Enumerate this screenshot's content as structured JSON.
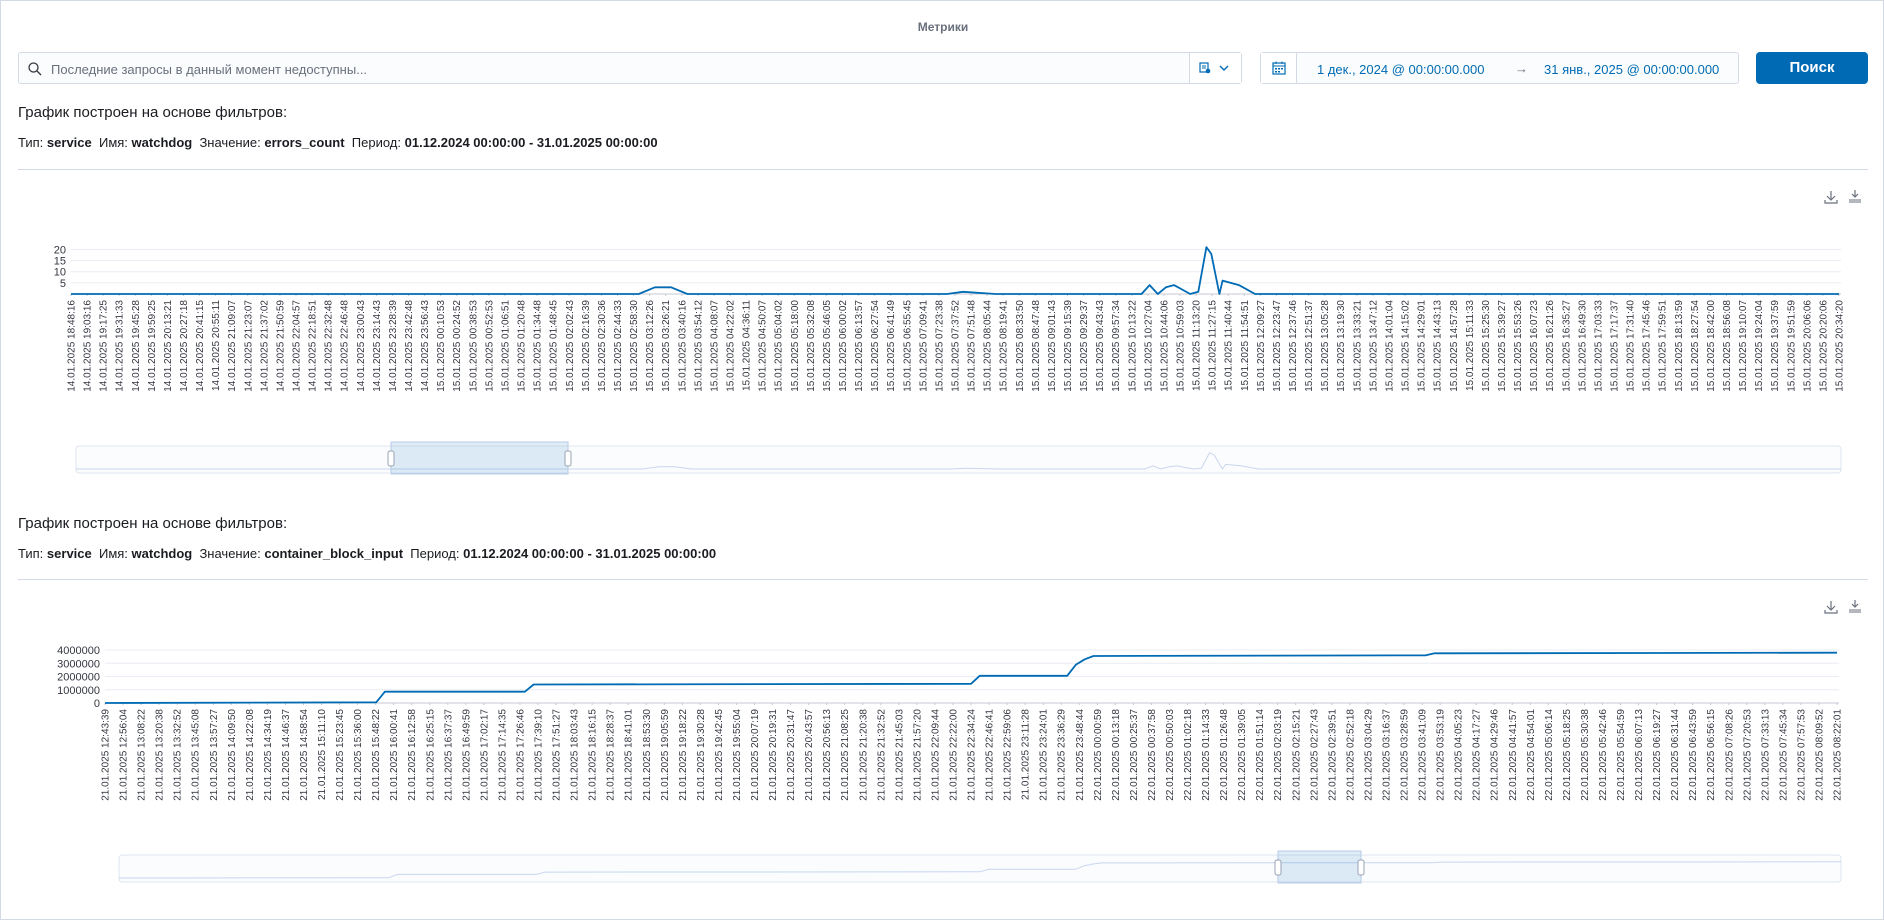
{
  "page": {
    "title": "Метрики"
  },
  "search": {
    "placeholder": "Последние запросы в данный момент недоступны..."
  },
  "date_picker": {
    "start": "1 дек., 2024 @ 00:00:00.000",
    "arrow": "→",
    "end": "31 янв., 2025 @ 00:00:00.000"
  },
  "search_button": {
    "label": "Поиск"
  },
  "colors": {
    "accent": "#006bb4",
    "line": "#006bb4",
    "border": "#d3dae6"
  },
  "icons": {
    "search": "search-icon",
    "query_menu": "saved-query-icon",
    "chevron": "chevron-down-icon",
    "calendar": "calendar-icon",
    "download": "download-icon",
    "download_alt": "download-alt-icon"
  },
  "charts": [
    {
      "heading": "График построен на основе фильтров:",
      "filters": {
        "type_label": "Тип:",
        "type_value": "service",
        "name_label": "Имя:",
        "name_value": "watchdog",
        "value_label": "Значение:",
        "value_value": "errors_count",
        "period_label": "Период:",
        "period_value": "01.12.2024 00:00:00 - 31.01.2025 00:00:00"
      }
    },
    {
      "heading": "График построен на основе фильтров:",
      "filters": {
        "type_label": "Тип:",
        "type_value": "service",
        "name_label": "Имя:",
        "name_value": "watchdog",
        "value_label": "Значение:",
        "value_value": "container_block_input",
        "period_label": "Период:",
        "period_value": "01.12.2024 00:00:00 - 31.01.2025 00:00:00"
      }
    }
  ],
  "chart_data": [
    {
      "type": "line",
      "yticks": [
        5,
        10,
        15,
        20
      ],
      "ylim": [
        0,
        22
      ],
      "xticks": [
        "14.01.2025 18:48:16",
        "14.01.2025 19:03:16",
        "14.01.2025 19:17:25",
        "14.01.2025 19:31:33",
        "14.01.2025 19:45:28",
        "14.01.2025 19:59:25",
        "14.01.2025 20:13:21",
        "14.01.2025 20:27:18",
        "14.01.2025 20:41:15",
        "14.01.2025 20:55:11",
        "14.01.2025 21:09:07",
        "14.01.2025 21:23:07",
        "14.01.2025 21:37:02",
        "14.01.2025 21:50:59",
        "14.01.2025 22:04:57",
        "14.01.2025 22:18:51",
        "14.01.2025 22:32:48",
        "14.01.2025 22:46:48",
        "14.01.2025 23:00:43",
        "14.01.2025 23:14:43",
        "14.01.2025 23:28:39",
        "14.01.2025 23:42:48",
        "14.01.2025 23:56:43",
        "15.01.2025 00:10:53",
        "15.01.2025 00:24:52",
        "15.01.2025 00:38:53",
        "15.01.2025 00:52:53",
        "15.01.2025 01:06:51",
        "15.01.2025 01:20:48",
        "15.01.2025 01:34:48",
        "15.01.2025 01:48:45",
        "15.01.2025 02:02:43",
        "15.01.2025 02:16:39",
        "15.01.2025 02:30:36",
        "15.01.2025 02:44:33",
        "15.01.2025 02:58:30",
        "15.01.2025 03:12:26",
        "15.01.2025 03:26:21",
        "15.01.2025 03:40:16",
        "15.01.2025 03:54:12",
        "15.01.2025 04:08:07",
        "15.01.2025 04:22:02",
        "15.01.2025 04:36:11",
        "15.01.2025 04:50:07",
        "15.01.2025 05:04:02",
        "15.01.2025 05:18:00",
        "15.01.2025 05:32:08",
        "15.01.2025 05:46:05",
        "15.01.2025 06:00:02",
        "15.01.2025 06:13:57",
        "15.01.2025 06:27:54",
        "15.01.2025 06:41:49",
        "15.01.2025 06:55:45",
        "15.01.2025 07:09:41",
        "15.01.2025 07:23:38",
        "15.01.2025 07:37:52",
        "15.01.2025 07:51:48",
        "15.01.2025 08:05:44",
        "15.01.2025 08:19:41",
        "15.01.2025 08:33:50",
        "15.01.2025 08:47:48",
        "15.01.2025 09:01:43",
        "15.01.2025 09:15:39",
        "15.01.2025 09:29:37",
        "15.01.2025 09:43:43",
        "15.01.2025 09:57:34",
        "15.01.2025 10:13:22",
        "15.01.2025 10:27:04",
        "15.01.2025 10:44:06",
        "15.01.2025 10:59:03",
        "15.01.2025 11:13:20",
        "15.01.2025 11:27:15",
        "15.01.2025 11:40:44",
        "15.01.2025 11:54:51",
        "15.01.2025 12:09:27",
        "15.01.2025 12:23:47",
        "15.01.2025 12:37:46",
        "15.01.2025 12:51:37",
        "15.01.2025 13:05:28",
        "15.01.2025 13:19:30",
        "15.01.2025 13:33:21",
        "15.01.2025 13:47:12",
        "15.01.2025 14:01:04",
        "15.01.2025 14:15:02",
        "15.01.2025 14:29:01",
        "15.01.2025 14:43:13",
        "15.01.2025 14:57:28",
        "15.01.2025 15:11:33",
        "15.01.2025 15:25:30",
        "15.01.2025 15:39:27",
        "15.01.2025 15:53:26",
        "15.01.2025 16:07:23",
        "15.01.2025 16:21:26",
        "15.01.2025 16:35:27",
        "15.01.2025 16:49:30",
        "15.01.2025 17:03:33",
        "15.01.2025 17:17:37",
        "15.01.2025 17:31:40",
        "15.01.2025 17:45:46",
        "15.01.2025 17:59:51",
        "15.01.2025 18:13:59",
        "15.01.2025 18:27:54",
        "15.01.2025 18:42:00",
        "15.01.2025 18:56:08",
        "15.01.2025 19:10:07",
        "15.01.2025 19:24:04",
        "15.01.2025 19:37:59",
        "15.01.2025 19:51:59",
        "15.01.2025 20:06:06",
        "15.01.2025 20:20:06",
        "15.01.2025 20:34:20"
      ],
      "x": [
        0,
        35,
        36,
        37,
        38,
        54,
        55,
        57,
        66,
        66.5,
        67,
        67.5,
        68,
        68.5,
        69,
        69.5,
        70,
        70.3,
        70.8,
        71,
        72,
        73,
        109
      ],
      "y": [
        0,
        0,
        3,
        3,
        0,
        0,
        1,
        0,
        0,
        4,
        0,
        3,
        4,
        2,
        0,
        1,
        21,
        18,
        0,
        6,
        4,
        0,
        0
      ]
    },
    {
      "type": "line",
      "yticks": [
        "0",
        "1000000",
        "2000000",
        "3000000",
        "4000000"
      ],
      "ylim": [
        0,
        4000000
      ],
      "xticks": [
        "21.01.2025 12:43:39",
        "21.01.2025 12:56:04",
        "21.01.2025 13:08:22",
        "21.01.2025 13:20:38",
        "21.01.2025 13:32:52",
        "21.01.2025 13:45:08",
        "21.01.2025 13:57:27",
        "21.01.2025 14:09:50",
        "21.01.2025 14:22:08",
        "21.01.2025 14:34:19",
        "21.01.2025 14:46:37",
        "21.01.2025 14:58:54",
        "21.01.2025 15:11:10",
        "21.01.2025 15:23:45",
        "21.01.2025 15:36:00",
        "21.01.2025 15:48:22",
        "21.01.2025 16:00:41",
        "21.01.2025 16:12:58",
        "21.01.2025 16:25:15",
        "21.01.2025 16:37:37",
        "21.01.2025 16:49:59",
        "21.01.2025 17:02:17",
        "21.01.2025 17:14:35",
        "21.01.2025 17:26:46",
        "21.01.2025 17:39:10",
        "21.01.2025 17:51:27",
        "21.01.2025 18:03:43",
        "21.01.2025 18:16:15",
        "21.01.2025 18:28:37",
        "21.01.2025 18:41:01",
        "21.01.2025 18:53:30",
        "21.01.2025 19:05:59",
        "21.01.2025 19:18:22",
        "21.01.2025 19:30:28",
        "21.01.2025 19:42:45",
        "21.01.2025 19:55:04",
        "21.01.2025 20:07:19",
        "21.01.2025 20:19:31",
        "21.01.2025 20:31:47",
        "21.01.2025 20:43:57",
        "21.01.2025 20:56:13",
        "21.01.2025 21:08:25",
        "21.01.2025 21:20:38",
        "21.01.2025 21:32:52",
        "21.01.2025 21:45:03",
        "21.01.2025 21:57:20",
        "21.01.2025 22:09:44",
        "21.01.2025 22:22:00",
        "21.01.2025 22:34:24",
        "21.01.2025 22:46:41",
        "21.01.2025 22:59:06",
        "21.01.2025 23:11:28",
        "21.01.2025 23:24:01",
        "21.01.2025 23:36:29",
        "21.01.2025 23:48:44",
        "22.01.2025 00:00:59",
        "22.01.2025 00:13:18",
        "22.01.2025 00:25:37",
        "22.01.2025 00:37:58",
        "22.01.2025 00:50:03",
        "22.01.2025 01:02:18",
        "22.01.2025 01:14:33",
        "22.01.2025 01:26:48",
        "22.01.2025 01:39:05",
        "22.01.2025 01:51:14",
        "22.01.2025 02:03:19",
        "22.01.2025 02:15:21",
        "22.01.2025 02:27:43",
        "22.01.2025 02:39:51",
        "22.01.2025 02:52:18",
        "22.01.2025 03:04:29",
        "22.01.2025 03:16:37",
        "22.01.2025 03:28:59",
        "22.01.2025 03:41:09",
        "22.01.2025 03:53:19",
        "22.01.2025 04:05:23",
        "22.01.2025 04:17:27",
        "22.01.2025 04:29:46",
        "22.01.2025 04:41:57",
        "22.01.2025 04:54:01",
        "22.01.2025 05:06:14",
        "22.01.2025 05:18:25",
        "22.01.2025 05:30:38",
        "22.01.2025 05:42:46",
        "22.01.2025 05:54:59",
        "22.01.2025 06:07:13",
        "22.01.2025 06:19:27",
        "22.01.2025 06:31:44",
        "22.01.2025 06:43:59",
        "22.01.2025 06:56:15",
        "22.01.2025 07:08:26",
        "22.01.2025 07:20:53",
        "22.01.2025 07:33:13",
        "22.01.2025 07:45:34",
        "22.01.2025 07:57:53",
        "22.01.2025 08:09:52",
        "22.01.2025 08:22:01"
      ],
      "x": [
        0,
        15.5,
        16,
        24,
        24.5,
        49.5,
        50,
        55,
        55.5,
        56,
        56.5,
        75.5,
        76,
        99
      ],
      "y": [
        0,
        50000,
        850000,
        850000,
        1400000,
        1450000,
        2050000,
        2050000,
        2900000,
        3300000,
        3550000,
        3600000,
        3750000,
        3800000
      ]
    }
  ]
}
